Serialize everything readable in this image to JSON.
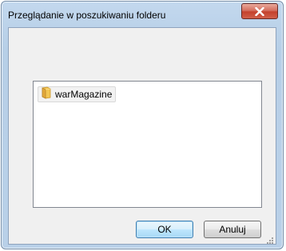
{
  "window": {
    "title": "Przeglądanie w poszukiwaniu folderu",
    "close_icon": "close-icon"
  },
  "tree": {
    "items": [
      {
        "label": "warMagazine",
        "icon": "folder-icon",
        "selected": true
      }
    ]
  },
  "buttons": {
    "ok_label": "OK",
    "cancel_label": "Anuluj"
  },
  "colors": {
    "close_button": "#c4412c",
    "window_frame": "#b9d0e8",
    "ok_button_border": "#3c7fb1"
  }
}
